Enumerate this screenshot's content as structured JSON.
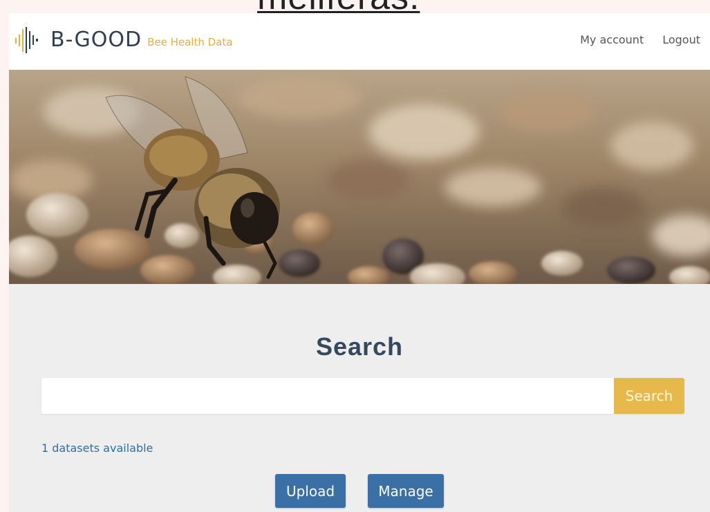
{
  "page_fragment": "meliferas.",
  "brand": {
    "name": "B-GOOD",
    "subtitle": "Bee Health Data",
    "colors": {
      "primary": "#2f3e52",
      "accent": "#e2b13c"
    }
  },
  "nav": {
    "my_account": "My account",
    "logout": "Logout"
  },
  "hero": {
    "image": "bee-on-gravel-photo"
  },
  "search": {
    "title": "Search",
    "placeholder": "",
    "value": "",
    "button_label": "Search"
  },
  "datasets": {
    "count_text": "1 datasets available"
  },
  "actions": {
    "upload_label": "Upload",
    "manage_label": "Manage"
  },
  "colors": {
    "button_primary": "#3a70a6",
    "button_search": "#e6b94a",
    "section_bg": "#eeeeee"
  }
}
